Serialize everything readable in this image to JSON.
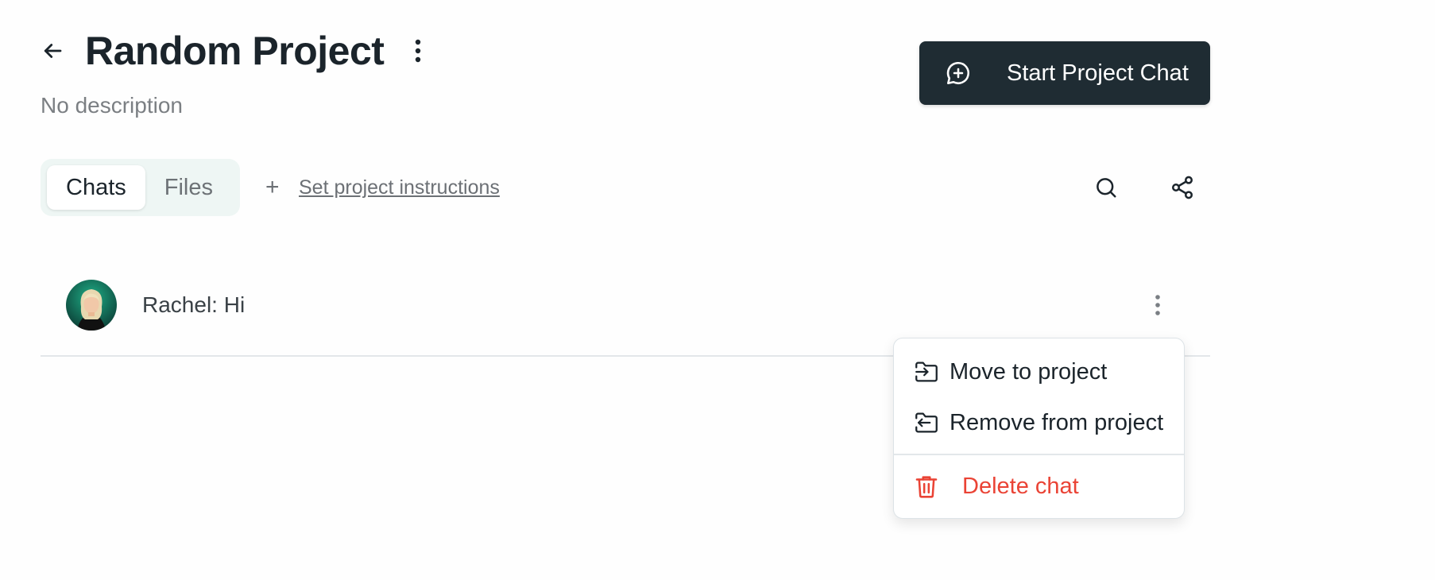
{
  "header": {
    "back_icon": "arrow-left-icon",
    "title": "Random Project",
    "more_icon": "more-vertical-icon",
    "description": "No description",
    "start_chat_label": "Start Project Chat",
    "start_chat_icon": "chat-plus-icon"
  },
  "tabs": [
    {
      "label": "Chats",
      "active": true
    },
    {
      "label": "Files",
      "active": false
    }
  ],
  "instructions": {
    "plus": "+",
    "label": "Set project instructions"
  },
  "toolbar": {
    "search_icon": "search-icon",
    "share_icon": "share-icon"
  },
  "chats": [
    {
      "title": "Rachel: Hi",
      "avatar": "avatar-photo"
    }
  ],
  "context_menu": {
    "items": [
      {
        "label": "Move to project",
        "icon": "folder-move-in-icon"
      },
      {
        "label": "Remove from project",
        "icon": "folder-move-out-icon"
      },
      {
        "label": "Delete chat",
        "icon": "trash-icon",
        "color": "#ea4335"
      }
    ]
  },
  "colors": {
    "primary_button": "#1f2c33",
    "danger": "#ea4335",
    "tab_background": "#eef6f4"
  }
}
